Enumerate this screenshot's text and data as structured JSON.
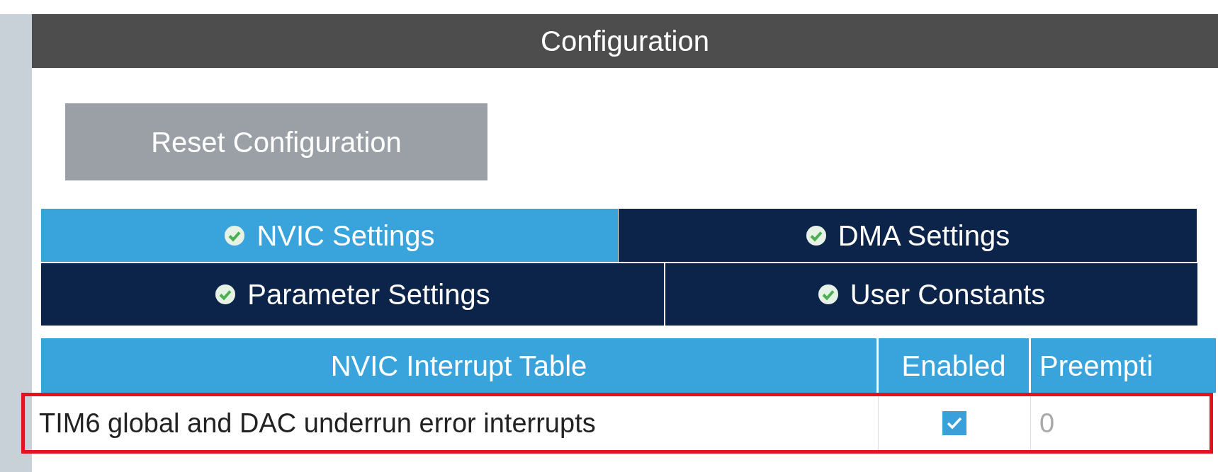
{
  "panel": {
    "title": "Configuration"
  },
  "reset_button": "Reset Configuration",
  "tabs": [
    {
      "label": "NVIC Settings",
      "selected": true,
      "checked": true
    },
    {
      "label": "DMA Settings",
      "selected": false,
      "checked": true
    },
    {
      "label": "Parameter Settings",
      "selected": false,
      "checked": true
    },
    {
      "label": "User Constants",
      "selected": false,
      "checked": true
    }
  ],
  "table": {
    "columns": [
      "NVIC Interrupt Table",
      "Enabled",
      "Preempti"
    ],
    "rows": [
      {
        "name": "TIM6 global and DAC underrun error interrupts",
        "enabled": true,
        "preemption": "0",
        "highlighted": true
      }
    ]
  }
}
